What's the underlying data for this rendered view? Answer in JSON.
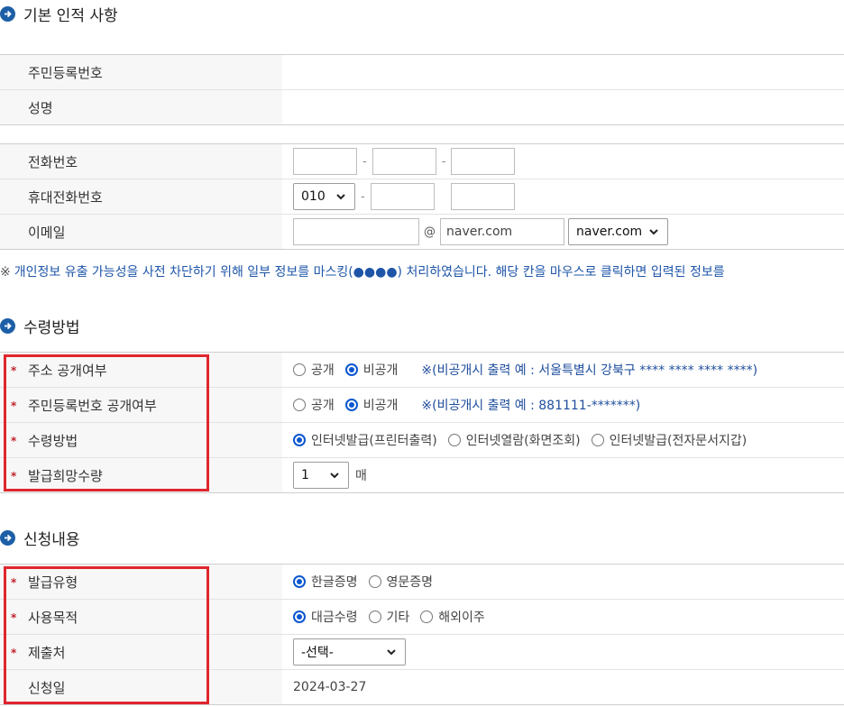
{
  "sections": {
    "basic": {
      "title": "기본 인적 사항"
    },
    "receive": {
      "title": "수령방법"
    },
    "request": {
      "title": "신청내용"
    }
  },
  "basic": {
    "rrn_label": "주민등록번호",
    "name_label": "성명",
    "phone_label": "전화번호",
    "mobile_label": "휴대전화번호",
    "mobile_prefix": "010",
    "email_label": "이메일",
    "email_at": "@",
    "email_domain_value": "naver.com",
    "email_domain_select": "naver.com",
    "dash": "-"
  },
  "notice": {
    "mark": "※",
    "text": "개인정보 유출 가능성을 사전 차단하기 위해 일부 정보를 마스킹(●●●●) 처리하였습니다. 해당 칸을 마우스로 클릭하면 입력된 정보를"
  },
  "receive": {
    "address_label": "주소 공개여부",
    "address_opt_public": "공개",
    "address_opt_private": "비공개",
    "address_note": "※(비공개시 출력 예 : 서울특별시 강북구 **** **** **** ****)",
    "rrn_label": "주민등록번호 공개여부",
    "rrn_opt_public": "공개",
    "rrn_opt_private": "비공개",
    "rrn_note": "※(비공개시 출력 예 : 881111-*******)",
    "method_label": "수령방법",
    "method_opt1": "인터넷발급(프린터출력)",
    "method_opt2": "인터넷열람(화면조회)",
    "method_opt3": "인터넷발급(전자문서지갑)",
    "qty_label": "발급희망수량",
    "qty_value": "1",
    "qty_unit": "매"
  },
  "request": {
    "type_label": "발급유형",
    "type_opt1": "한글증명",
    "type_opt2": "영문증명",
    "purpose_label": "사용목적",
    "purpose_opt1": "대금수령",
    "purpose_opt2": "기타",
    "purpose_opt3": "해외이주",
    "submit_label": "제출처",
    "submit_value": "-선택-",
    "date_label": "신청일",
    "date_value": "2024-03-27"
  },
  "required_mark": "*",
  "colors": {
    "accent": "#0b57d0",
    "highlight": "#e0262e",
    "notice": "#1e55a8"
  }
}
